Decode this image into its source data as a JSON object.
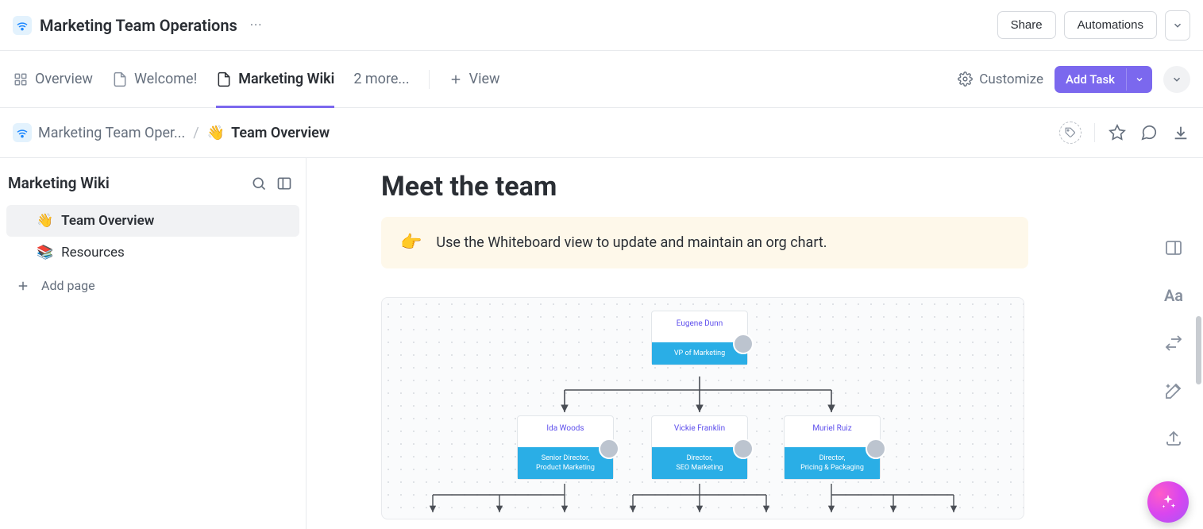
{
  "header": {
    "space_title": "Marketing Team Operations",
    "share_label": "Share",
    "automations_label": "Automations"
  },
  "tabs": {
    "items": [
      {
        "label": "Overview",
        "icon": "grid-icon"
      },
      {
        "label": "Welcome!",
        "icon": "doc-icon"
      },
      {
        "label": "Marketing Wiki",
        "icon": "doc-icon"
      }
    ],
    "more_label": "2 more...",
    "add_view_label": "View",
    "customize_label": "Customize",
    "add_task_label": "Add Task"
  },
  "breadcrumb": {
    "space": "Marketing Team Oper...",
    "page_emoji": "👋",
    "page": "Team Overview"
  },
  "sidebar": {
    "title": "Marketing Wiki",
    "items": [
      {
        "emoji": "👋",
        "label": "Team Overview",
        "active": true
      },
      {
        "emoji": "📚",
        "label": "Resources",
        "active": false
      }
    ],
    "add_page_label": "Add page"
  },
  "page": {
    "heading": "Meet the team",
    "callout_emoji": "👉",
    "callout_text": "Use the Whiteboard view to update and maintain an org chart."
  },
  "orgchart": {
    "root": {
      "name": "Eugene Dunn",
      "role": "VP of Marketing"
    },
    "children": [
      {
        "name": "Ida Woods",
        "role": "Senior Director,\nProduct Marketing"
      },
      {
        "name": "Vickie Franklin",
        "role": "Director,\nSEO Marketing"
      },
      {
        "name": "Muriel Ruiz",
        "role": "Director,\nPricing & Packaging"
      }
    ]
  }
}
